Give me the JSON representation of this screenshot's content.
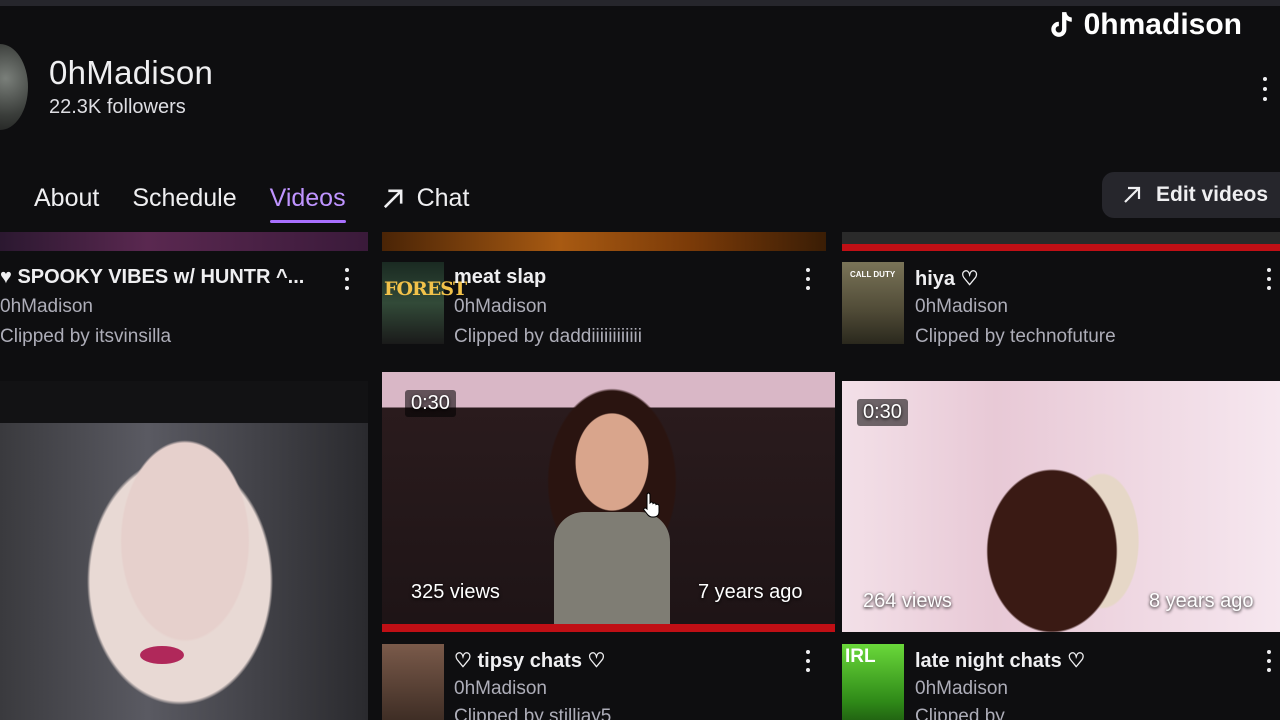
{
  "watermark": {
    "handle": "0hmadison",
    "icon": "tiktok-icon"
  },
  "channel": {
    "name": "0hMadison",
    "followers": "22.3K followers"
  },
  "tabs": [
    {
      "label": "About",
      "active": false
    },
    {
      "label": "Schedule",
      "active": false
    },
    {
      "label": "Videos",
      "active": true
    },
    {
      "label": "Chat",
      "active": false,
      "icon": "external-arrow-icon"
    }
  ],
  "edit_button": {
    "label": "Edit videos",
    "icon": "external-arrow-icon"
  },
  "accent_color": "#a970ff",
  "row1": [
    {
      "title": "SPOOKY VIBES w/ HUNTR ^...",
      "channel": "0hMadison",
      "clipped": "Clipped by itsvinsilla",
      "prefix_icon": "heart-icon"
    },
    {
      "title": "meat slap",
      "channel": "0hMadison",
      "clipped": "Clipped by daddiiiiiiiiiiii",
      "game_logo": "FOREST"
    },
    {
      "title": "hiya ♡",
      "channel": "0hMadison",
      "clipped": "Clipped by technofuture",
      "game_logo": "CALL DUTY"
    }
  ],
  "row2": [
    {
      "duration": "",
      "views": "",
      "age": ""
    },
    {
      "duration": "0:30",
      "views": "325 views",
      "age": "7 years ago"
    },
    {
      "duration": "0:30",
      "views": "264 views",
      "age": "8 years ago"
    }
  ],
  "row3": [
    {
      "title": "♡ tipsy chats ♡",
      "channel": "0hMadison",
      "clipped": "Clipped by stilljay5"
    },
    {
      "title": "late night chats ♡",
      "channel": "0hMadison",
      "clipped": "Clipped by",
      "game_logo": "IRL"
    }
  ]
}
